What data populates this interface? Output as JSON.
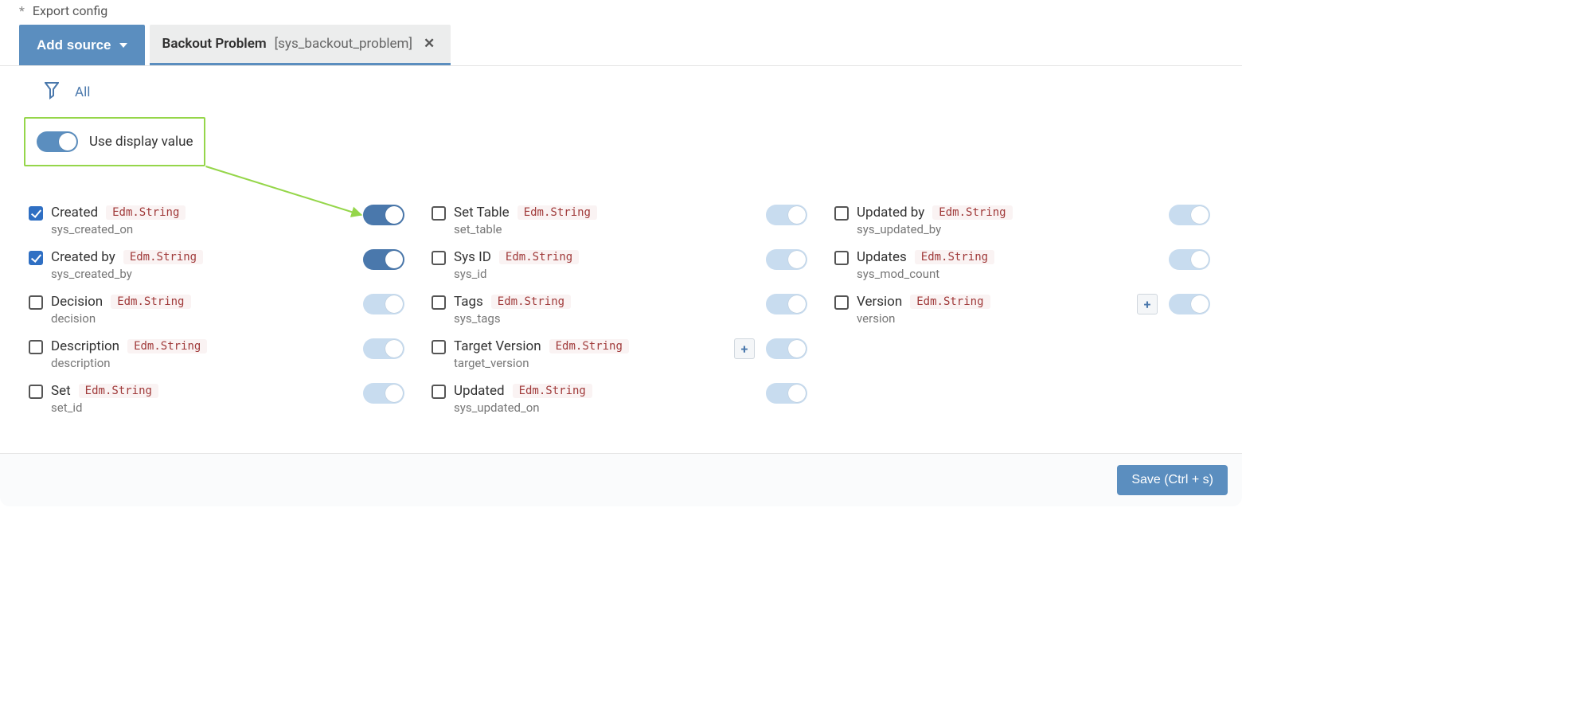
{
  "topLabel": "Export config",
  "addSourceLabel": "Add source",
  "tab": {
    "name": "Backout Problem",
    "tech": "[sys_backout_problem]"
  },
  "filterLabel": "All",
  "displayValueLabel": "Use display value",
  "displayValueOn": true,
  "saveLabel": "Save (Ctrl + s)",
  "colors": {
    "primary": "#5b8ebf",
    "highlight": "#95d64a",
    "typeBadge": "#a03a3a"
  },
  "columns": [
    [
      {
        "label": "Created",
        "type": "Edm.String",
        "tech": "sys_created_on",
        "checked": true,
        "toggleOn": true,
        "plus": false
      },
      {
        "label": "Created by",
        "type": "Edm.String",
        "tech": "sys_created_by",
        "checked": true,
        "toggleOn": true,
        "plus": false
      },
      {
        "label": "Decision",
        "type": "Edm.String",
        "tech": "decision",
        "checked": false,
        "toggleOn": false,
        "plus": false
      },
      {
        "label": "Description",
        "type": "Edm.String",
        "tech": "description",
        "checked": false,
        "toggleOn": false,
        "plus": false
      },
      {
        "label": "Set",
        "type": "Edm.String",
        "tech": "set_id",
        "checked": false,
        "toggleOn": false,
        "plus": false
      }
    ],
    [
      {
        "label": "Set Table",
        "type": "Edm.String",
        "tech": "set_table",
        "checked": false,
        "toggleOn": false,
        "plus": false
      },
      {
        "label": "Sys ID",
        "type": "Edm.String",
        "tech": "sys_id",
        "checked": false,
        "toggleOn": false,
        "plus": false
      },
      {
        "label": "Tags",
        "type": "Edm.String",
        "tech": "sys_tags",
        "checked": false,
        "toggleOn": false,
        "plus": false
      },
      {
        "label": "Target Version",
        "type": "Edm.String",
        "tech": "target_version",
        "checked": false,
        "toggleOn": false,
        "plus": true
      },
      {
        "label": "Updated",
        "type": "Edm.String",
        "tech": "sys_updated_on",
        "checked": false,
        "toggleOn": false,
        "plus": false
      }
    ],
    [
      {
        "label": "Updated by",
        "type": "Edm.String",
        "tech": "sys_updated_by",
        "checked": false,
        "toggleOn": false,
        "plus": false
      },
      {
        "label": "Updates",
        "type": "Edm.String",
        "tech": "sys_mod_count",
        "checked": false,
        "toggleOn": false,
        "plus": false
      },
      {
        "label": "Version",
        "type": "Edm.String",
        "tech": "version",
        "checked": false,
        "toggleOn": false,
        "plus": true
      }
    ]
  ]
}
